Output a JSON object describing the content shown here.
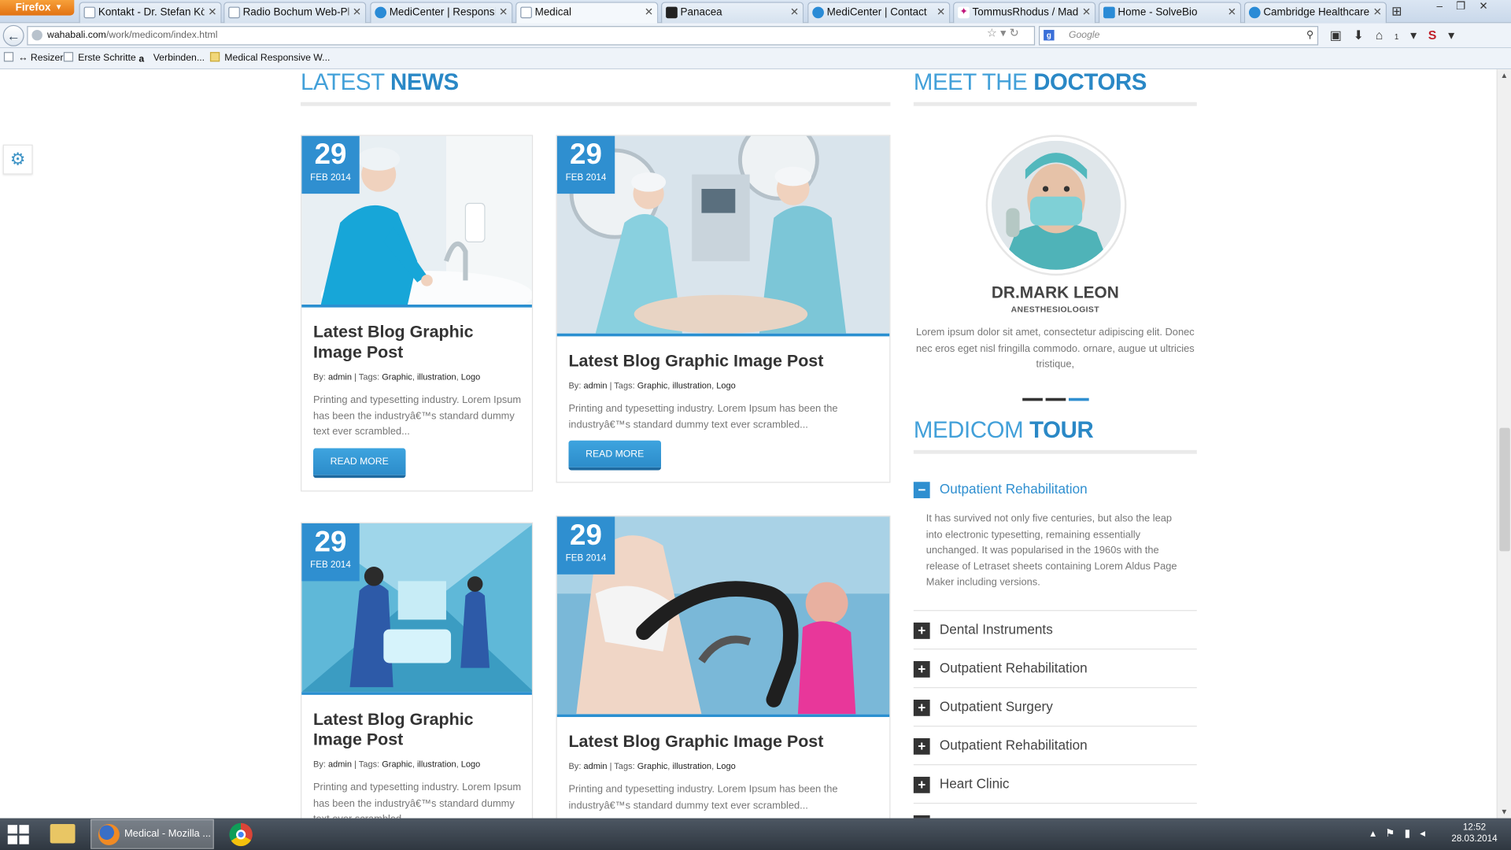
{
  "browser": {
    "firefox_button": "Firefox",
    "tabs": [
      {
        "label": "Kontakt - Dr. Stefan Köni...",
        "icon": "page-icon"
      },
      {
        "label": "Radio Bochum Web-Player",
        "icon": "page-icon"
      },
      {
        "label": "MediCenter | Responsive ...",
        "icon": "medicenter-icon"
      },
      {
        "label": "Medical",
        "icon": "page-icon",
        "active": true
      },
      {
        "label": "Panacea",
        "icon": "panacea-icon"
      },
      {
        "label": "MediCenter | Contact",
        "icon": "medicenter-icon"
      },
      {
        "label": "TommusRhodus / Madel...",
        "icon": "dribbble-icon"
      },
      {
        "label": "Home - SolveBio",
        "icon": "solvebio-icon"
      },
      {
        "label": "Cambridge Healthcare",
        "icon": "cambridge-icon"
      }
    ],
    "url_host": "wahabali.com",
    "url_path": "/work/medicom/index.html",
    "search_placeholder": "Google",
    "badge_count": "1",
    "bookmarks": [
      {
        "label": "↔ Resizer"
      },
      {
        "label": "Erste Schritte"
      },
      {
        "label": "Verbinden..."
      },
      {
        "label": "Medical Responsive W..."
      }
    ]
  },
  "page": {
    "latest_news": {
      "title_light": "LATEST ",
      "title_bold": "NEWS"
    },
    "posts": [
      {
        "day": "29",
        "month": "FEB 2014",
        "title": "Latest Blog Graphic Image Post",
        "by": "By:",
        "author": "admin",
        "tags_label": "| Tags:",
        "tags": [
          "Graphic",
          "illustration",
          "Logo"
        ],
        "excerpt": "Printing and typesetting industry. Lorem Ipsum has been the industryâ€™s standard dummy text ever scrambled...",
        "button": "READ MORE"
      },
      {
        "day": "29",
        "month": "FEB 2014",
        "title": "Latest Blog Graphic Image Post",
        "by": "By:",
        "author": "admin",
        "tags_label": "| Tags:",
        "tags": [
          "Graphic",
          "illustration",
          "Logo"
        ],
        "excerpt": "Printing and typesetting industry. Lorem Ipsum has been the industryâ€™s standard dummy text ever scrambled...",
        "button": "READ MORE"
      },
      {
        "day": "29",
        "month": "FEB 2014",
        "title": "Latest Blog Graphic Image Post",
        "by": "By:",
        "author": "admin",
        "tags_label": "| Tags:",
        "tags": [
          "Graphic",
          "illustration",
          "Logo"
        ],
        "excerpt": "Printing and typesetting industry. Lorem Ipsum has been the industryâ€™s standard dummy text ever scrambled..."
      },
      {
        "day": "29",
        "month": "FEB 2014",
        "title": "Latest Blog Graphic Image Post",
        "by": "By:",
        "author": "admin",
        "tags_label": "| Tags:",
        "tags": [
          "Graphic",
          "illustration",
          "Logo"
        ],
        "excerpt": "Printing and typesetting industry. Lorem Ipsum has been the industryâ€™s standard dummy text ever scrambled..."
      }
    ],
    "doctors": {
      "title_light": "MEET THE ",
      "title_bold": "DOCTORS",
      "name": "DR.MARK LEON",
      "role": "ANESTHESIOLOGIST",
      "bio": "Lorem ipsum dolor sit amet, consectetur adipiscing elit. Donec nec eros eget nisl fringilla commodo. ornare, augue ut ultricies tristique,"
    },
    "tour": {
      "title_light": "MEDICOM ",
      "title_bold": "TOUR",
      "open_item": "Outpatient Rehabilitation",
      "open_text": "It has survived not only five centuries, but also the leap into electronic typesetting, remaining essentially unchanged. It was popularised in the 1960s with the release of Letraset sheets containing Lorem Aldus Page Maker including versions.",
      "items": [
        "Dental Instruments",
        "Outpatient Rehabilitation",
        "Outpatient Surgery",
        "Outpatient Rehabilitation",
        "Heart Clinic"
      ]
    }
  },
  "taskbar": {
    "active_window": "Medical - Mozilla ...",
    "time": "12:52",
    "date": "28.03.2014"
  },
  "colors": {
    "accent": "#2f8fd0",
    "title_blue": "#42a0d9"
  }
}
